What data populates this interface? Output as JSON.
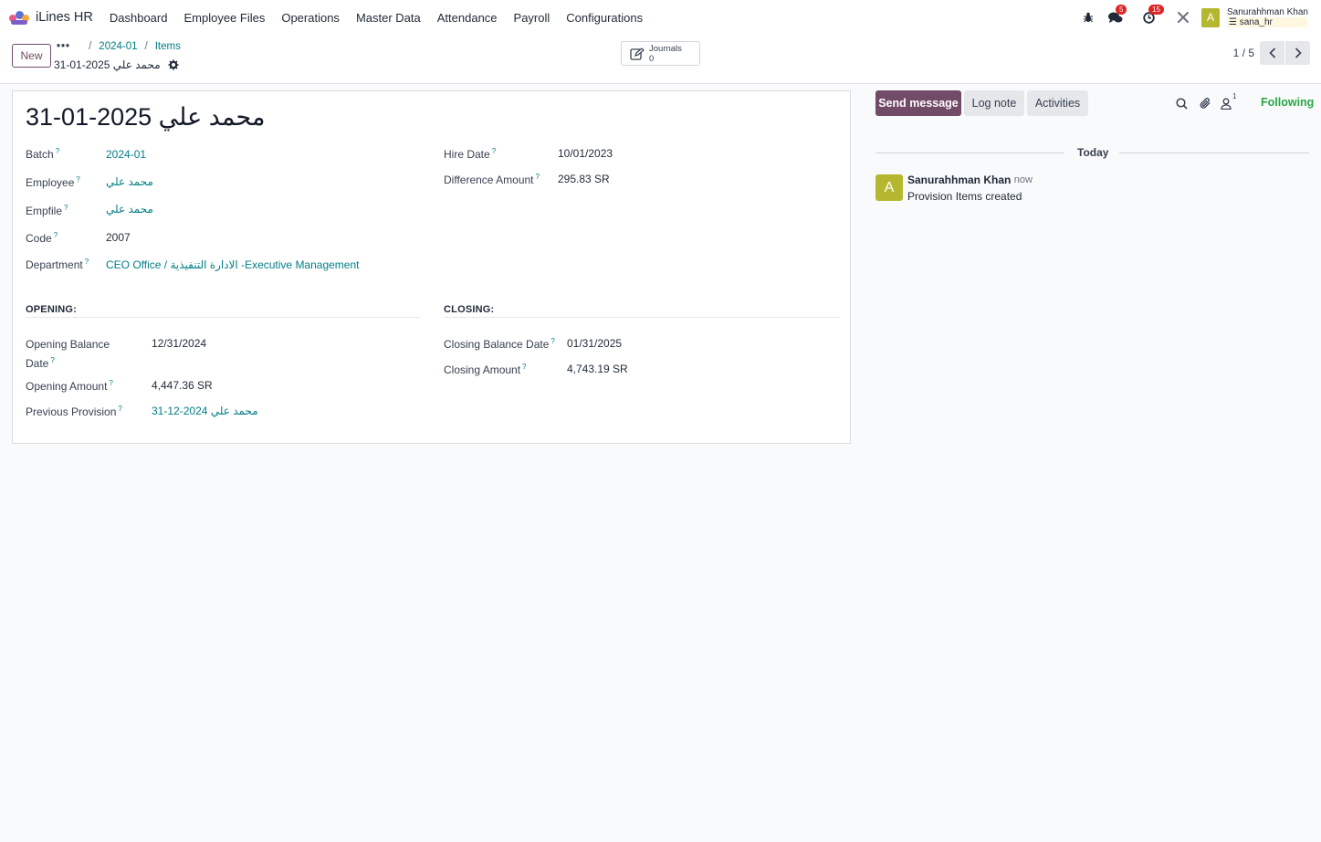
{
  "navbar": {
    "brand": "iLines HR",
    "menu": [
      "Dashboard",
      "Employee Files",
      "Operations",
      "Master Data",
      "Attendance",
      "Payroll",
      "Configurations"
    ],
    "messages_badge": "5",
    "activities_badge": "15",
    "user_initial": "A",
    "user_name": "Sanurahhman Khan",
    "user_db": "sana_hr",
    "icons": [
      "bug-icon",
      "chat-icon",
      "clock-icon",
      "tools-icon"
    ]
  },
  "control": {
    "new_label": "New",
    "breadcrumb": [
      "2024-01",
      "Items"
    ],
    "record_name": "محمد علي 2025-01-31",
    "smart_button": {
      "label": "Journals",
      "count": "0"
    },
    "pager": "1 / 5"
  },
  "form": {
    "title": "محمد علي 2025-01-31",
    "tooltip_mark": "?",
    "left_fields": [
      {
        "label": "Batch",
        "value": "2024-01"
      },
      {
        "label": "Employee",
        "value": "محمد علي"
      },
      {
        "label": "Empfile",
        "value": "محمد علي"
      },
      {
        "label": "Code",
        "value": "2007"
      },
      {
        "label": "Department",
        "value": "CEO Office / الادارة التنفيذية -Executive Management"
      }
    ],
    "right_fields": [
      {
        "label": "Hire Date",
        "value": "10/01/2023"
      },
      {
        "label": "Difference Amount",
        "value": "295.83 SR"
      }
    ],
    "opening": {
      "title": "OPENING:",
      "fields": [
        {
          "label_line1": "Opening Balance",
          "label_line2": "Date",
          "value": "12/31/2024"
        },
        {
          "label": "Opening Amount",
          "value": "4,447.36 SR"
        },
        {
          "label": "Previous Provision",
          "value": "محمد علي 2024-12-31"
        }
      ]
    },
    "closing": {
      "title": "CLOSING:",
      "fields": [
        {
          "label": "Closing Balance Date",
          "value": "01/31/2025"
        },
        {
          "label": "Closing Amount",
          "value": "4,743.19 SR"
        }
      ]
    }
  },
  "chatter": {
    "send_message": "Send message",
    "log_note": "Log note",
    "activities": "Activities",
    "follower_count": "1",
    "following": "Following",
    "date_separator": "Today",
    "messages": [
      {
        "avatar": "A",
        "author": "Sanurahhman Khan",
        "time": "- now",
        "body": "Provision Items created"
      }
    ]
  },
  "colors": {
    "brand": "#714b67",
    "link": "#017e84",
    "following": "#28a745",
    "badge": "#dc2626"
  }
}
